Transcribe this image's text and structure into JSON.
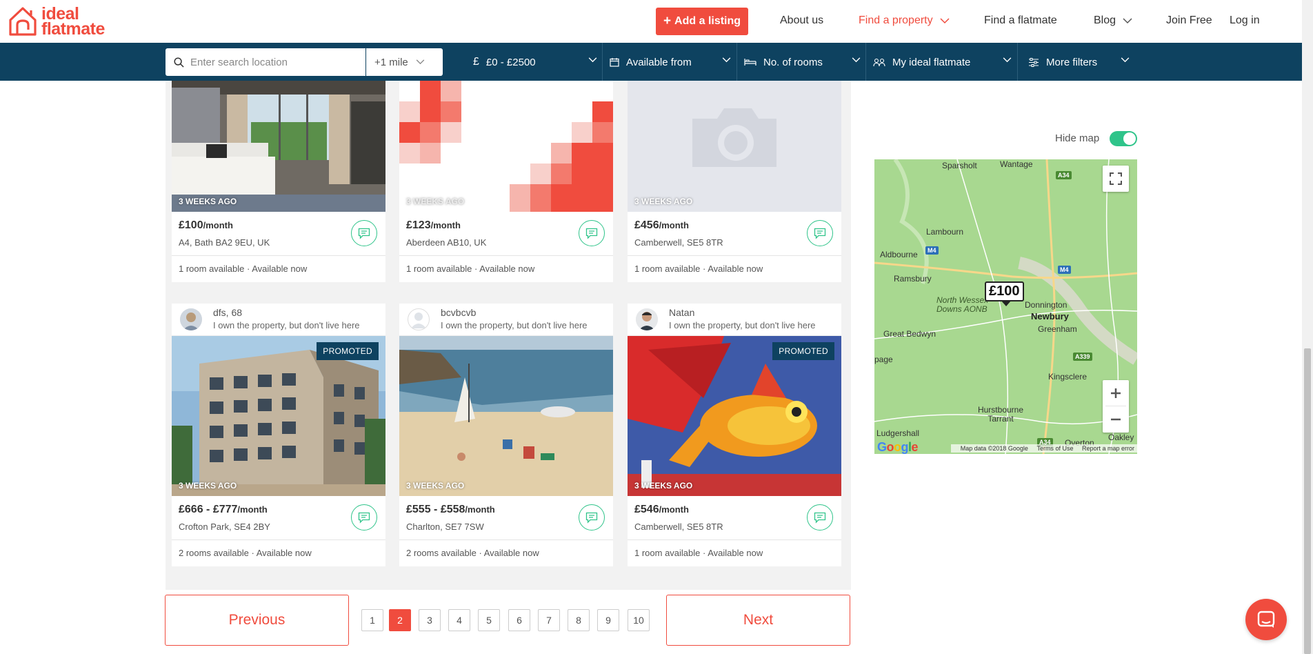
{
  "brand": {
    "line1": "ideal",
    "line2": "flatmate",
    "accent": "#f04c3e",
    "navy": "#0e4260",
    "green": "#2fc48a"
  },
  "header": {
    "add_listing": "Add a listing",
    "nav": [
      "About us",
      "Find a property",
      "Find a flatmate",
      "Blog",
      "Join Free",
      "Log in"
    ],
    "active_nav": "Find a property"
  },
  "search": {
    "placeholder": "Enter search location",
    "radius": "+1 mile",
    "filters": {
      "price": "£0 - £2500",
      "available": "Available from",
      "rooms": "No. of rooms",
      "flatmate": "My ideal flatmate",
      "more": "More filters"
    }
  },
  "listings": [
    {
      "ago": "3 WEEKS AGO",
      "price": "£100",
      "per": "/month",
      "address": "A4, Bath BA2 9EU, UK",
      "availability": "1 room available · Available now",
      "photo": "hotel-room"
    },
    {
      "ago": "3 WEEKS AGO",
      "price": "£123",
      "per": "/month",
      "address": "Aberdeen AB10, UK",
      "availability": "1 room available · Available now",
      "photo": "pixel-pattern"
    },
    {
      "ago": "3 WEEKS AGO",
      "price": "£456",
      "per": "/month",
      "address": "Camberwell, SE5 8TR",
      "availability": "1 room available · Available now",
      "photo": "placeholder-camera"
    },
    {
      "owner": "dfs, 68",
      "owner_desc": "I own the property, but don't live here",
      "promoted": "PROMOTED",
      "ago": "3 WEEKS AGO",
      "price": "£666 - £777",
      "per": "/month",
      "address": "Crofton Park, SE4 2BY",
      "availability": "2 rooms available · Available now",
      "photo": "apartment-building"
    },
    {
      "owner": "bcvbcvb",
      "owner_desc": "I own the property, but don't live here",
      "ago": "3 WEEKS AGO",
      "price": "£555 - £558",
      "per": "/month",
      "address": "Charlton, SE7 7SW",
      "availability": "2 rooms available · Available now",
      "photo": "beach"
    },
    {
      "owner": "Natan",
      "owner_desc": "I own the property, but don't live here",
      "promoted": "PROMOTED",
      "ago": "3 WEEKS AGO",
      "price": "£546",
      "per": "/month",
      "address": "Camberwell, SE5 8TR",
      "availability": "1 room available · Available now",
      "photo": "fish-sculpture"
    }
  ],
  "pagination": {
    "previous": "Previous",
    "next": "Next",
    "pages": [
      "1",
      "2",
      "3",
      "4",
      "5",
      "6",
      "7",
      "8",
      "9",
      "10"
    ],
    "current": "2"
  },
  "map": {
    "hide_label": "Hide map",
    "pin": "£100",
    "places": [
      "Sparsholt",
      "Wantage",
      "Lambourn",
      "Aldbourne",
      "Ramsbury",
      "North Wessex Downs AONB",
      "Donnington",
      "Newbury",
      "Greenham",
      "Great Bedwyn",
      "Kingsclere",
      "Hurstbourne Tarrant",
      "Ludgershall",
      "Overton",
      "Oakley",
      "page"
    ],
    "roads": [
      "A34",
      "M4",
      "M4",
      "A339",
      "A34"
    ],
    "attribution": {
      "data": "Map data ©2018 Google",
      "terms": "Terms of Use",
      "report": "Report a map error"
    },
    "google": "Google"
  }
}
